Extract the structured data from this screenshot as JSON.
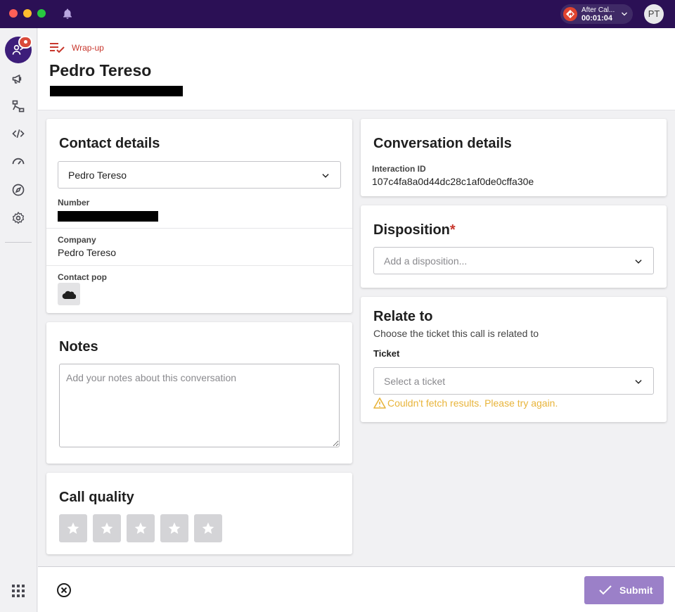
{
  "titlebar": {
    "status": {
      "label": "After Cal...",
      "timer": "00:01:04"
    },
    "avatar_initials": "PT"
  },
  "header": {
    "section_label": "Wrap-up",
    "contact_name": "Pedro Tereso"
  },
  "contact_details": {
    "title": "Contact details",
    "selected_contact": "Pedro Tereso",
    "number_label": "Number",
    "company_label": "Company",
    "company_value": "Pedro Tereso",
    "contact_pop_label": "Contact pop"
  },
  "notes": {
    "title": "Notes",
    "placeholder": "Add your notes about this conversation"
  },
  "call_quality": {
    "title": "Call quality",
    "rating": 0,
    "max_rating": 5
  },
  "conversation_details": {
    "title": "Conversation details",
    "interaction_id_label": "Interaction ID",
    "interaction_id": "107c4fa8a0d44dc28c1af0de0cffa30e"
  },
  "disposition": {
    "title": "Disposition",
    "required_mark": "*",
    "placeholder": "Add a disposition..."
  },
  "relate_to": {
    "title": "Relate to",
    "subtitle": "Choose the ticket this call is related to",
    "ticket_label": "Ticket",
    "ticket_placeholder": "Select a ticket",
    "error": "Couldn't fetch results. Please try again."
  },
  "footer": {
    "submit_label": "Submit"
  },
  "colors": {
    "titlebar": "#2b1055",
    "accent": "#3d1d7a",
    "error_red": "#c8372d",
    "warning": "#e8b43a",
    "submit": "#9b80c8"
  },
  "icons": {
    "sidebar": [
      "agent-icon",
      "campaign-icon",
      "workflow-icon",
      "code-icon",
      "speedometer-icon",
      "compass-icon",
      "gear-icon",
      "apps-grid-icon"
    ]
  }
}
